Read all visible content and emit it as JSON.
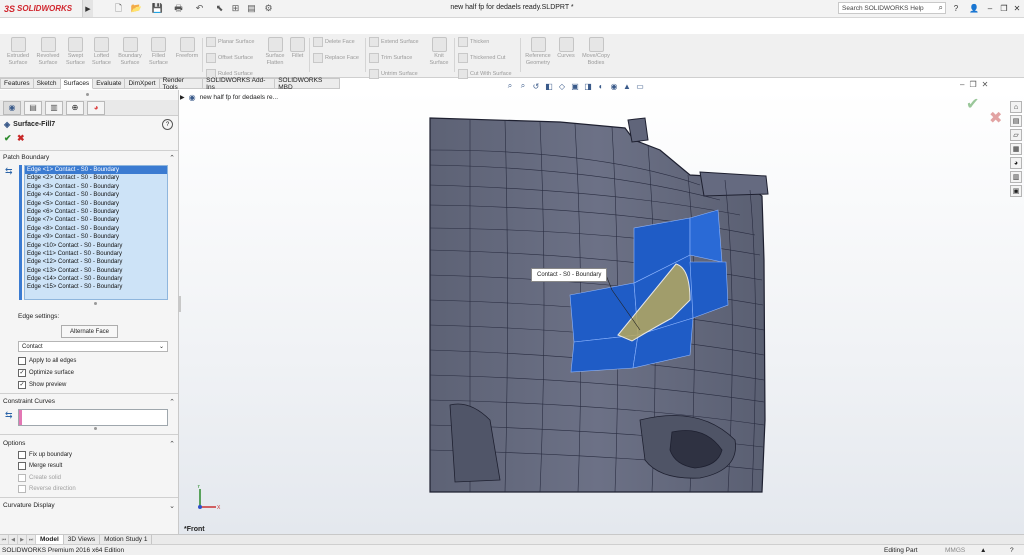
{
  "app": {
    "logo_ds": "3S",
    "logo_text": "SOLIDWORKS",
    "document_title": "new half fp for dedaels ready.SLDPRT *",
    "search_placeholder": "Search SOLIDWORKS Help"
  },
  "ribbon": {
    "tools": [
      {
        "label": "Extruded\nSurface",
        "icon": "extruded-surface-icon"
      },
      {
        "label": "Revolved\nSurface",
        "icon": "revolved-surface-icon"
      },
      {
        "label": "Swept\nSurface",
        "icon": "swept-surface-icon"
      },
      {
        "label": "Lofted\nSurface",
        "icon": "lofted-surface-icon"
      },
      {
        "label": "Boundary\nSurface",
        "icon": "boundary-surface-icon"
      },
      {
        "label": "Filled\nSurface",
        "icon": "filled-surface-icon"
      },
      {
        "label": "Freeform",
        "icon": "freeform-icon"
      }
    ],
    "col1": [
      "Planar Surface",
      "Offset Surface",
      "Ruled Surface"
    ],
    "flatten": "Surface\nFlatten",
    "fillet": "Fillet",
    "col2": [
      "Delete Face",
      "Replace Face"
    ],
    "col3": [
      "Extend Surface",
      "Trim Surface",
      "Untrim Surface"
    ],
    "knit": "Knit\nSurface",
    "col4": [
      "Thicken",
      "Thickened Cut",
      "Cut With Surface"
    ],
    "refgeom": "Reference\nGeometry",
    "curves": "Curves",
    "movecopy": "Move/Copy\nBodies"
  },
  "command_tabs": [
    "Features",
    "Sketch",
    "Surfaces",
    "Evaluate",
    "DimXpert",
    "Render Tools",
    "SOLIDWORKS Add-Ins",
    "SOLIDWORKS MBD"
  ],
  "active_command_tab": "Surfaces",
  "tree_item": "new half fp for dedaels re...",
  "property_manager": {
    "title": "Surface-Fill7",
    "patch_boundary_label": "Patch Boundary",
    "edges": [
      "Edge <1> Contact - S0 - Boundary",
      "Edge <2> Contact - S0 - Boundary",
      "Edge <3> Contact - S0 - Boundary",
      "Edge <4> Contact - S0 - Boundary",
      "Edge <5> Contact - S0 - Boundary",
      "Edge <6> Contact - S0 - Boundary",
      "Edge <7> Contact - S0 - Boundary",
      "Edge <8> Contact - S0 - Boundary",
      "Edge <9> Contact - S0 - Boundary",
      "Edge <10> Contact - S0 - Boundary",
      "Edge <11> Contact - S0 - Boundary",
      "Edge <12> Contact - S0 - Boundary",
      "Edge <13> Contact - S0 - Boundary",
      "Edge <14> Contact - S0 - Boundary",
      "Edge <15> Contact - S0 - Boundary"
    ],
    "edge_settings_label": "Edge settings:",
    "alternate_face_label": "Alternate Face",
    "edge_condition": "Contact",
    "apply_all_edges": {
      "label": "Apply to all edges",
      "checked": false
    },
    "optimize_surface": {
      "label": "Optimize surface",
      "checked": true
    },
    "show_preview": {
      "label": "Show preview",
      "checked": true
    },
    "constraint_curves_label": "Constraint Curves",
    "options_label": "Options",
    "fix_up_boundary": {
      "label": "Fix up boundary",
      "checked": false
    },
    "merge_result": {
      "label": "Merge result",
      "checked": false
    },
    "create_solid": {
      "label": "Create solid",
      "checked": false
    },
    "reverse_direction": {
      "label": "Reverse direction",
      "checked": false
    },
    "curvature_display_label": "Curvature Display"
  },
  "viewport": {
    "callout": "Contact - S0 - Boundary",
    "view_name": "*Front"
  },
  "bottom_tabs": [
    "Model",
    "3D Views",
    "Motion Study 1"
  ],
  "active_bottom_tab": "Model",
  "status": {
    "edition": "SOLIDWORKS Premium 2016 x64 Edition",
    "mode": "Editing Part",
    "units": "MMGS"
  },
  "colors": {
    "selection_blue": "#1f5cc6",
    "accent_red": "#d1262e",
    "list_bg": "#cde3f7"
  }
}
